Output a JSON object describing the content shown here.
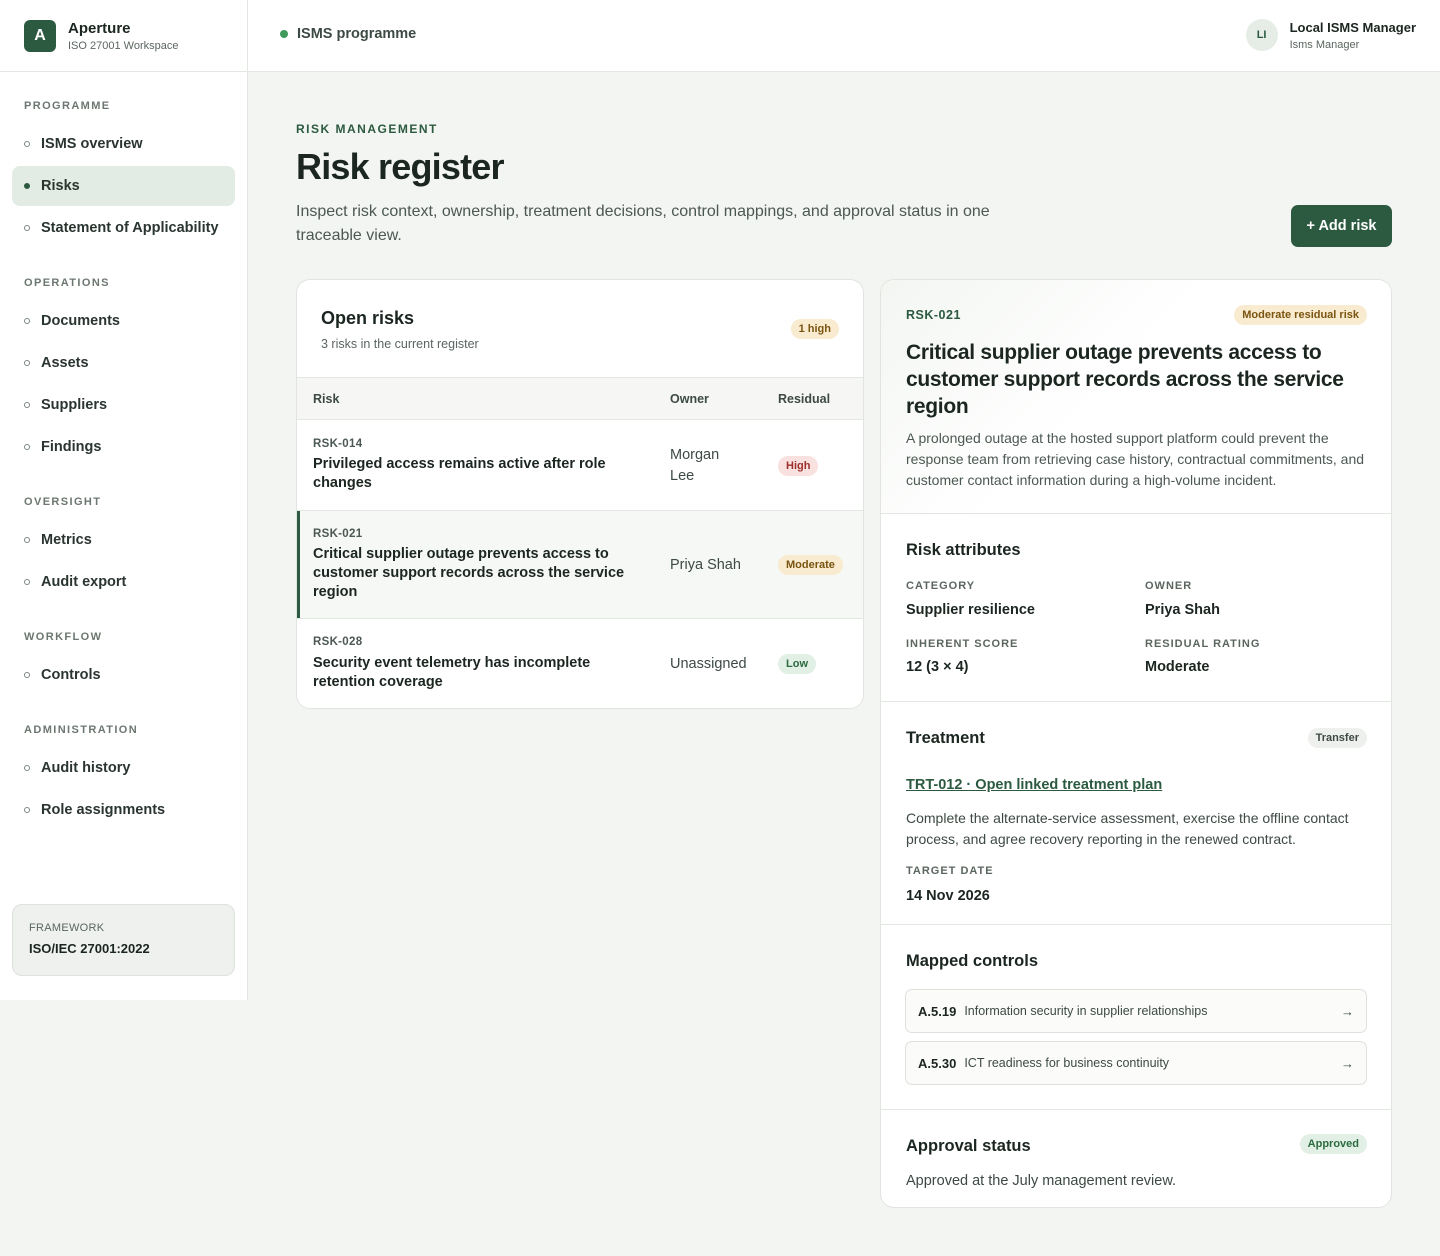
{
  "brand": {
    "logo_letter": "A",
    "name": "Aperture",
    "subtitle": "ISO 27001 Workspace"
  },
  "nav": {
    "sections": [
      {
        "title": "PROGRAMME",
        "items": [
          "ISMS overview",
          "Risks",
          "Statement of Applicability"
        ]
      },
      {
        "title": "OPERATIONS",
        "items": [
          "Documents",
          "Assets",
          "Suppliers",
          "Findings"
        ]
      },
      {
        "title": "OVERSIGHT",
        "items": [
          "Metrics",
          "Audit export"
        ]
      },
      {
        "title": "WORKFLOW",
        "items": [
          "Controls"
        ]
      },
      {
        "title": "ADMINISTRATION",
        "items": [
          "Audit history",
          "Role assignments"
        ]
      }
    ],
    "active": "Risks"
  },
  "framework": {
    "label": "FRAMEWORK",
    "value": "ISO/IEC 27001:2022"
  },
  "topbar": {
    "programme": "ISMS programme"
  },
  "user": {
    "initials": "LI",
    "name": "Local ISMS Manager",
    "role": "Isms Manager"
  },
  "header": {
    "eyebrow": "RISK MANAGEMENT",
    "title": "Risk register",
    "description": "Inspect risk context, ownership, treatment decisions, control mappings, and approval status in one traceable view.",
    "add_button": "+ Add risk"
  },
  "risk_list": {
    "title": "Open risks",
    "subtitle": "3 risks in the current register",
    "badge": "1 high",
    "columns": {
      "risk": "Risk",
      "owner": "Owner",
      "residual": "Residual"
    },
    "rows": [
      {
        "id": "RSK-014",
        "title": "Privileged access remains active after role changes",
        "owner": "Morgan Lee",
        "residual": "High"
      },
      {
        "id": "RSK-021",
        "title": "Critical supplier outage prevents access to customer support records across the service region",
        "owner": "Priya Shah",
        "residual": "Moderate"
      },
      {
        "id": "RSK-028",
        "title": "Security event telemetry has incomplete retention coverage",
        "owner": "Unassigned",
        "residual": "Low"
      }
    ]
  },
  "detail": {
    "id": "RSK-021",
    "risk_badge": "Moderate residual risk",
    "title": "Critical supplier outage prevents access to customer support records across the service region",
    "description": "A prolonged outage at the hosted support platform could prevent the response team from retrieving case history, contractual commitments, and customer contact information during a high-volume incident.",
    "attributes": {
      "title": "Risk attributes",
      "category_label": "CATEGORY",
      "category": "Supplier resilience",
      "owner_label": "OWNER",
      "owner": "Priya Shah",
      "inherent_label": "INHERENT SCORE",
      "inherent": "12 (3 × 4)",
      "residual_label": "RESIDUAL RATING",
      "residual": "Moderate"
    },
    "treatment": {
      "title": "Treatment",
      "badge": "Transfer",
      "link": "TRT-012 · Open linked treatment plan",
      "description": "Complete the alternate-service assessment, exercise the offline contact process, and agree recovery reporting in the renewed contract.",
      "target_label": "TARGET DATE",
      "target": "14 Nov 2026"
    },
    "controls": {
      "title": "Mapped controls",
      "items": [
        {
          "code": "A.5.19",
          "name": "Information security in supplier relationships",
          "arrow": "→"
        },
        {
          "code": "A.5.30",
          "name": "ICT readiness for business continuity",
          "arrow": "→"
        }
      ]
    },
    "approval": {
      "title": "Approval status",
      "badge": "Approved",
      "text": "Approved at the July management review."
    }
  }
}
